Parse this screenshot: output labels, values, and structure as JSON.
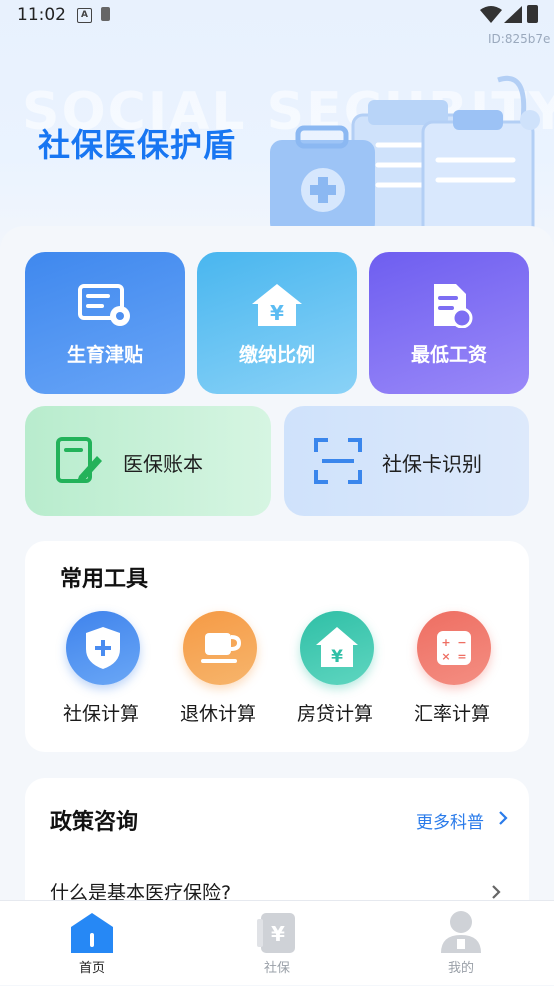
{
  "status_bar": {
    "time": "11:02",
    "a_icon": "A"
  },
  "id_tag": "ID:825b7e",
  "hero": {
    "watermark": "SOCIAL SECURITY",
    "title": "社保医保护盾"
  },
  "tiles": [
    {
      "label": "生育津贴",
      "icon": "id-card-gear-icon"
    },
    {
      "label": "缴纳比例",
      "icon": "house-yen-icon"
    },
    {
      "label": "最低工资",
      "icon": "document-coin-icon"
    }
  ],
  "wide_tiles": [
    {
      "label": "医保账本",
      "icon": "ledger-pen-icon"
    },
    {
      "label": "社保卡识别",
      "icon": "scan-frame-icon"
    }
  ],
  "tools": {
    "title": "常用工具",
    "items": [
      {
        "label": "社保计算",
        "icon": "shield-plus-icon"
      },
      {
        "label": "退休计算",
        "icon": "coffee-cup-icon"
      },
      {
        "label": "房贷计算",
        "icon": "house-yen-icon"
      },
      {
        "label": "汇率计算",
        "icon": "calculator-icon"
      }
    ]
  },
  "policy": {
    "title": "政策咨询",
    "more": "更多科普",
    "questions": [
      "什么是基本医疗保险?"
    ]
  },
  "nav": {
    "items": [
      {
        "label": "首页",
        "active": true
      },
      {
        "label": "社保",
        "active": false
      },
      {
        "label": "我的",
        "active": false
      }
    ]
  },
  "colors": {
    "accent": "#1876f2",
    "bg": "#f3f6fb"
  }
}
